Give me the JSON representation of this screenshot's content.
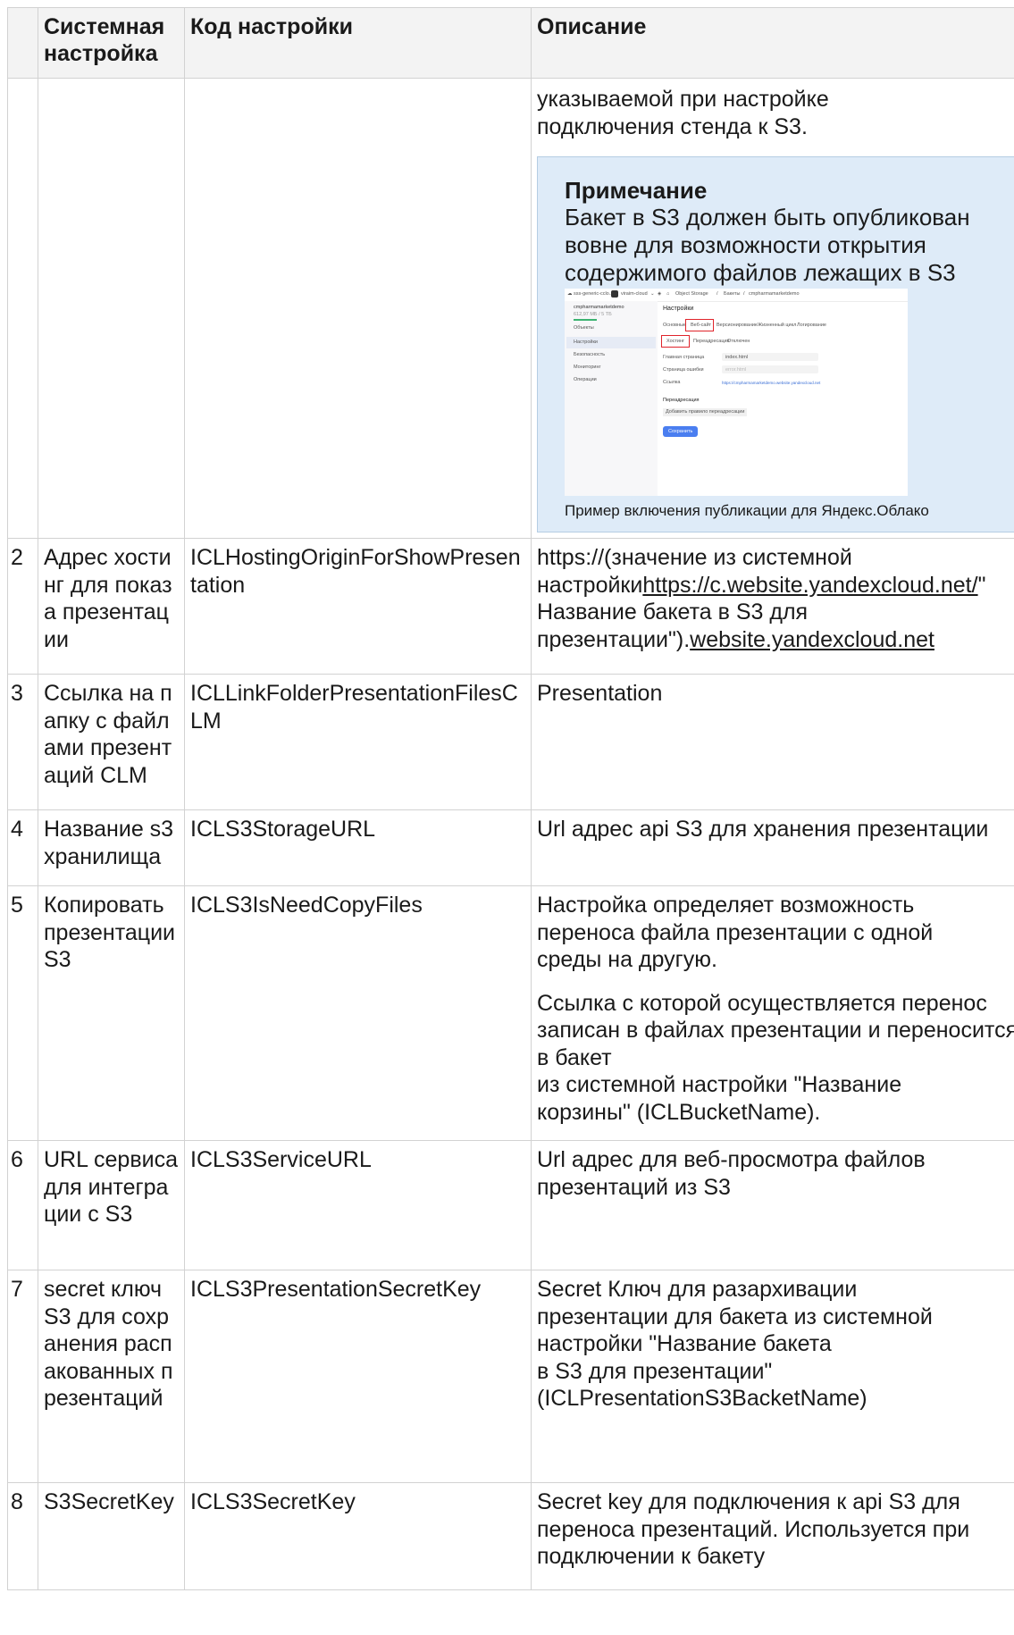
{
  "table": {
    "headers": [
      "",
      "Системная настройка",
      "Код настройки",
      "Описание"
    ],
    "continuation": {
      "description_text": "указываемой при настройке подключения стенда к S3.",
      "note": {
        "title": "Примечание",
        "body": "Бакет в S3 должен быть опубликован вовне для возможности открытия содержимого файлов лежащих в S3",
        "caption": "Пример включения публикации для Яндекс.Облако"
      }
    },
    "rows": [
      {
        "num": "2",
        "name": "Адрес хостинг для показа презентации",
        "code": "ICLHostingOriginForShowPresentation",
        "desc_pre": "https://(значение из системной настройки",
        "desc_link": "https://c.website.yandexcloud.net/",
        "desc_mid": "\" Название бакета в S3 для презентации\").",
        "desc_link2": "website.yandexcloud.net"
      },
      {
        "num": "3",
        "name": "Ссылка на папку с файлами презентаций CLM",
        "code": "ICLLinkFolderPresentationFilesCLM",
        "desc": "Presentation"
      },
      {
        "num": "4",
        "name": "Название s3 хранилища",
        "code": "ICLS3StorageURL",
        "desc": "Url адрес api S3 для хранения презентации"
      },
      {
        "num": "5",
        "name": "Копировать презентации S3",
        "code": "ICLS3IsNeedCopyFiles",
        "desc": "Настройка определяет возможность переноса файла презентации с одной среды на другую.",
        "desc2_a": "Ссылка с которой осуществляется перенос записан в файлах презентации и переносится в бакет",
        "desc2_b": "из системной настройки \"Название корзины\" (ICLBucketName)."
      },
      {
        "num": "6",
        "name": "URL сервиса для интеграции с S3",
        "code": "ICLS3ServiceURL",
        "desc": "Url адрес для веб-просмотра файлов презентаций из S3"
      },
      {
        "num": "7",
        "name": "secret ключ S3 для сохранения распакованных презентаций",
        "code": "ICLS3PresentationSecretKey",
        "desc_a": "Secret Ключ для разархивации презентации для бакета из системной настройки \"Название бакета",
        "desc_b": "в S3 для презентации\" (ICLPresentationS3BacketName)"
      },
      {
        "num": "8",
        "name": "S3SecretKey",
        "code": "ICLS3SecretKey",
        "desc": "Secret key для подключения к api S3 для переноса презентаций. Используется при подключении к бакету"
      }
    ]
  },
  "screenshot": {
    "top_crumbs": [
      "Object Storage",
      "Бакеты",
      "cmpharmamarketdemo"
    ],
    "top_left": "sss-generic-cclo...",
    "top_cloud": "viraim-cloud",
    "bucket_name": "cmpharmamarketdemo",
    "bucket_size": "612,97 МБ / 5 ТБ",
    "side_items": [
      "Объекты",
      "Настройки",
      "Безопасность",
      "Мониторинг",
      "Операции"
    ],
    "heading": "Настройки",
    "tabs": [
      "Основные",
      "Веб-сайт",
      "Версионирование",
      "Жизненный цикл",
      "Логирование"
    ],
    "subtabs": [
      "Хостинг",
      "Переадресация",
      "Отключен"
    ],
    "field_labels": [
      "Главная страница",
      "Страница ошибки",
      "Ссылка"
    ],
    "field_values": [
      "index.html",
      "error.html",
      "https://cmpharmamarketdemo.website.yandexcloud.net"
    ],
    "redirect_heading": "Переадресация",
    "redirect_rule": "Добавить правило переадресации",
    "save_button": "Сохранить"
  },
  "colors": {
    "note_bg": "#deebf8",
    "header_bg": "#f3f3f3",
    "grid": "#d2d2d2",
    "highlight": "#e0242b",
    "save_button": "#4a7ef0"
  }
}
